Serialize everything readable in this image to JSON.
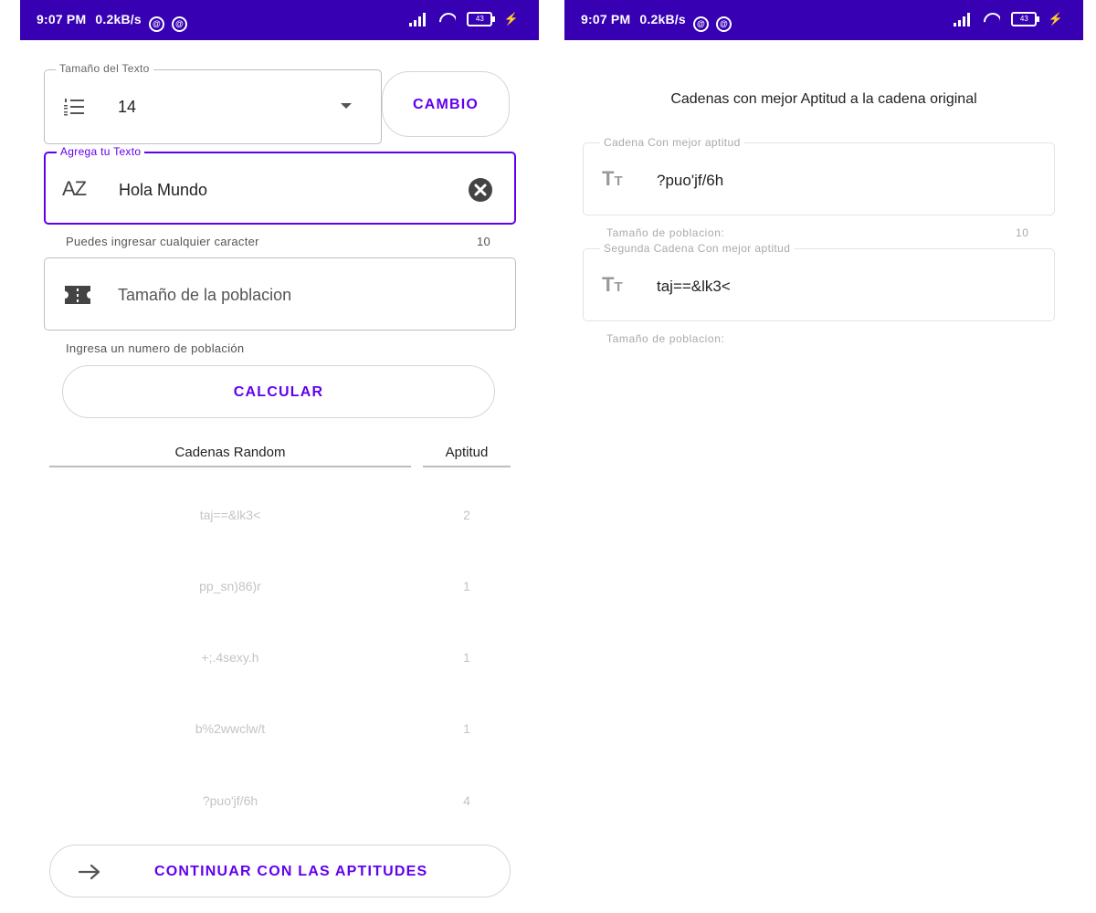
{
  "status_bar": {
    "time": "9:07 PM",
    "speed": "0.2kB/s",
    "battery": "43"
  },
  "screen1": {
    "size_field": {
      "label": "Tamaño del Texto",
      "value": "14"
    },
    "change_button": "CAMBIO",
    "text_field": {
      "label": "Agrega tu Texto",
      "value": "Hola Mundo",
      "helper": "Puedes ingresar cualquier caracter",
      "counter": "10"
    },
    "population_field": {
      "placeholder": "Tamaño de la poblacion",
      "helper": "Ingresa un numero de población"
    },
    "calculate_button": "CALCULAR",
    "table": {
      "headers": [
        "Cadenas Random",
        "Aptitud"
      ],
      "rows": [
        {
          "string": "taj==&lk3<",
          "fitness": "2"
        },
        {
          "string": "pp_sn)86)r",
          "fitness": "1"
        },
        {
          "string": "+;.4sexy.h",
          "fitness": "1"
        },
        {
          "string": "b%2wwclw/t",
          "fitness": "1"
        },
        {
          "string": "?puo'jf/6h",
          "fitness": "4"
        }
      ]
    },
    "continue_button": "CONTINUAR CON LAS APTITUDES"
  },
  "screen2": {
    "title": "Cadenas con mejor Aptitud a la cadena original",
    "best": {
      "label": "Cadena Con mejor aptitud",
      "value": "?puo'jf/6h",
      "helper": "Tamaño de poblacion:",
      "helper_value": "10"
    },
    "second": {
      "label": "Segunda Cadena Con mejor aptitud",
      "value": "taj==&lk3<",
      "helper": "Tamaño de poblacion:"
    }
  },
  "icons": {
    "size": "format-list-numbered-icon",
    "dropdown": "arrow-drop-down-icon",
    "text": "sort-az-icon",
    "clear": "cancel-circle-icon",
    "population": "ticket-icon",
    "continue": "arrow-right-icon",
    "text_format": "format-size-icon"
  },
  "colors": {
    "status_bar": "#3700b3",
    "accent": "#6200ee"
  }
}
